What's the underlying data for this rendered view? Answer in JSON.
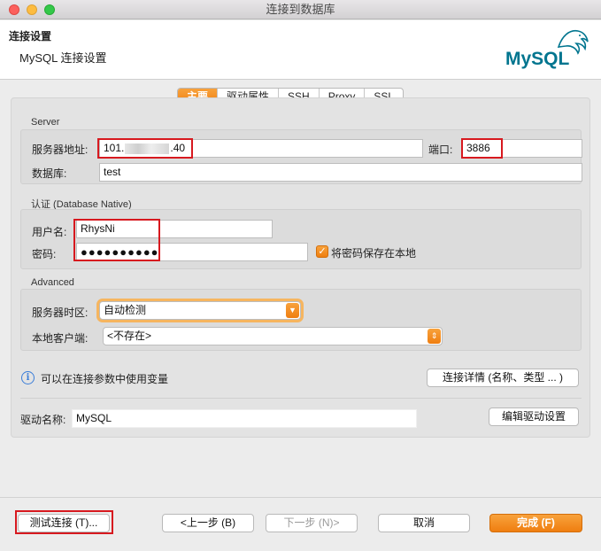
{
  "window": {
    "title": "连接到数据库"
  },
  "header": {
    "title": "连接设置",
    "subtitle": "MySQL 连接设置",
    "logo_text": "MySQL"
  },
  "tabs": [
    {
      "label": "主要",
      "active": true
    },
    {
      "label": "驱动属性",
      "active": false
    },
    {
      "label": "SSH",
      "active": false
    },
    {
      "label": "Proxy",
      "active": false
    },
    {
      "label": "SSL",
      "active": false
    }
  ],
  "server": {
    "section_label": "Server",
    "host_label": "服务器地址:",
    "host_value_prefix": "101.",
    "host_value_suffix": ".40",
    "port_label": "端口:",
    "port_value": "3886",
    "database_label": "数据库:",
    "database_value": "test"
  },
  "auth": {
    "section_label": "认证 (Database Native)",
    "username_label": "用户名:",
    "username_value": "RhysNi",
    "password_label": "密码:",
    "password_value": "●●●●●●●●●●",
    "save_password_label": "将密码保存在本地",
    "save_password_checked": true
  },
  "advanced": {
    "section_label": "Advanced",
    "timezone_label": "服务器时区:",
    "timezone_value": "自动检测",
    "local_client_label": "本地客户端:",
    "local_client_value": "<不存在>"
  },
  "info": {
    "variables_text": "可以在连接参数中使用变量",
    "details_button": "连接详情 (名称、类型 ... )"
  },
  "driver": {
    "label": "驱动名称:",
    "value": "MySQL",
    "edit_button": "编辑驱动设置"
  },
  "footer": {
    "test_button": "测试连接 (T)...",
    "back_button": "<上一步 (B)",
    "next_button": "下一步 (N)>",
    "cancel_button": "取消",
    "finish_button": "完成 (F)"
  },
  "colors": {
    "accent": "#ef7e10",
    "highlight_box": "#d7191f",
    "info": "#3a7dd8",
    "mysql_blue": "#00758f",
    "mysql_orange": "#f29111"
  }
}
